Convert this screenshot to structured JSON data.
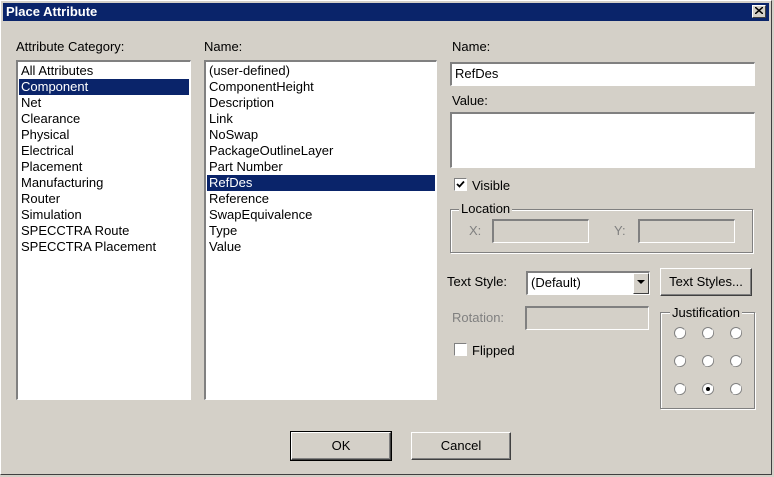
{
  "window": {
    "title": "Place Attribute"
  },
  "category": {
    "label": "Attribute Category:",
    "items": [
      "All Attributes",
      "Component",
      "Net",
      "Clearance",
      "Physical",
      "Electrical",
      "Placement",
      "Manufacturing",
      "Router",
      "Simulation",
      "SPECCTRA Route",
      "SPECCTRA Placement"
    ],
    "selected": "Component"
  },
  "names": {
    "label": "Name:",
    "items": [
      "(user-defined)",
      "ComponentHeight",
      "Description",
      "Link",
      "NoSwap",
      "PackageOutlineLayer",
      "Part Number",
      "RefDes",
      "Reference",
      "SwapEquivalence",
      "Type",
      "Value"
    ],
    "selected": "RefDes"
  },
  "fields": {
    "name_label": "Name:",
    "name_value": "RefDes",
    "value_label": "Value:",
    "value_value": "",
    "visible_label": "Visible",
    "visible_checked": true,
    "location_label": "Location",
    "x_label": "X:",
    "y_label": "Y:",
    "text_style_label": "Text Style:",
    "text_style_value": "(Default)",
    "text_styles_button": "Text Styles...",
    "rotation_label": "Rotation:",
    "flipped_label": "Flipped",
    "flipped_checked": false,
    "justification_label": "Justification",
    "justification_selected": "bottom-center"
  },
  "buttons": {
    "ok": "OK",
    "cancel": "Cancel"
  }
}
